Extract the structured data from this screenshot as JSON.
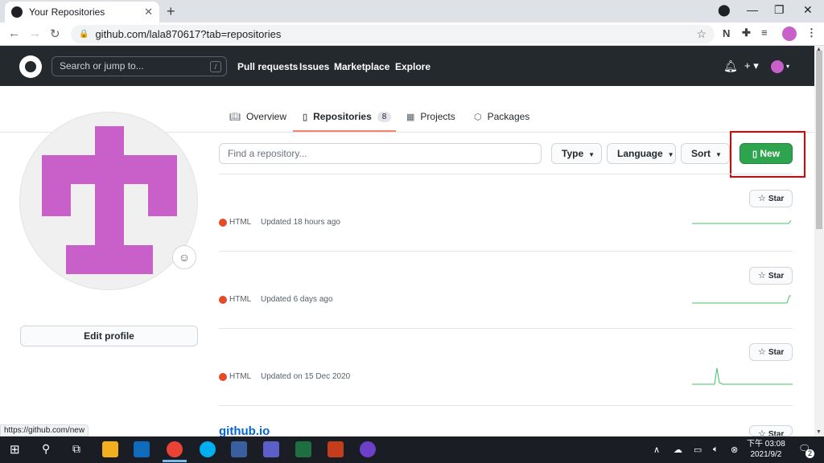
{
  "browser": {
    "tab_title": "Your Repositories",
    "tab_close": "✕",
    "new_tab": "+",
    "url": "github.com/lala870617?tab=repositories",
    "status_url": "https://github.com/new"
  },
  "gh_header": {
    "search_placeholder": "Search or jump to...",
    "search_shortcut": "/",
    "nav": [
      "Pull requests",
      "Issues",
      "Marketplace",
      "Explore"
    ],
    "plus": "+ ▾"
  },
  "profile_tabs": [
    {
      "label": "Overview",
      "icon": "book-icon"
    },
    {
      "label": "Repositories",
      "icon": "repo-icon",
      "count": "8"
    },
    {
      "label": "Projects",
      "icon": "project-icon"
    },
    {
      "label": "Packages",
      "icon": "package-icon"
    }
  ],
  "sidebar": {
    "edit_profile": "Edit profile",
    "avatar_color": "#c95fc8"
  },
  "filters": {
    "find_placeholder": "Find a repository...",
    "type": "Type",
    "language": "Language",
    "sort": "Sort",
    "new_label": "New"
  },
  "repos": [
    {
      "language": "HTML",
      "updated": "Updated 18 hours ago",
      "star_label": "Star"
    },
    {
      "language": "HTML",
      "updated": "Updated 6 days ago",
      "star_label": "Star"
    },
    {
      "language": "HTML",
      "updated": "Updated on 15 Dec 2020",
      "star_label": "Star"
    },
    {
      "title": "github.io",
      "star_label": "Star"
    }
  ],
  "taskbar": {
    "clock_time": "下午 03:08",
    "clock_date": "2021/9/2",
    "notifications": "2"
  },
  "colors": {
    "accent_green": "#2ea44f",
    "highlight_red": "#e00000",
    "html_lang": "#e34c26",
    "header_bg": "#24292e"
  }
}
